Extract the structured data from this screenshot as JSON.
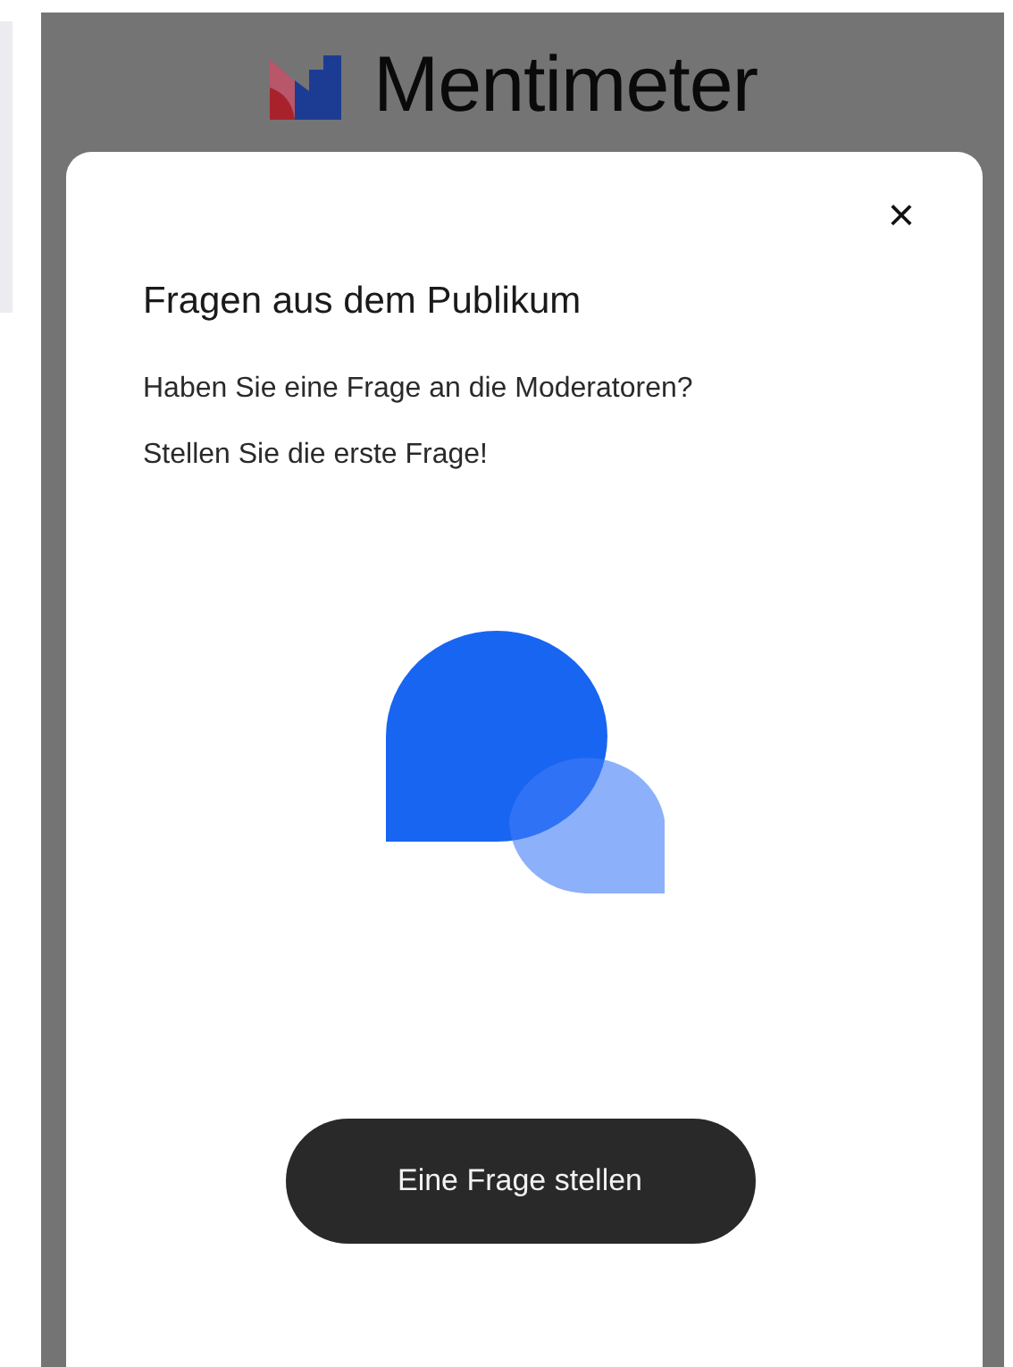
{
  "header": {
    "logo_text": "Mentimeter"
  },
  "modal": {
    "close": "×",
    "title": "Fragen aus dem Publikum",
    "description_lines": [
      "Haben Sie eine Frage an die Moderatoren?",
      "Stellen Sie die erste Frage!"
    ],
    "button": "Eine Frage stellen"
  }
}
